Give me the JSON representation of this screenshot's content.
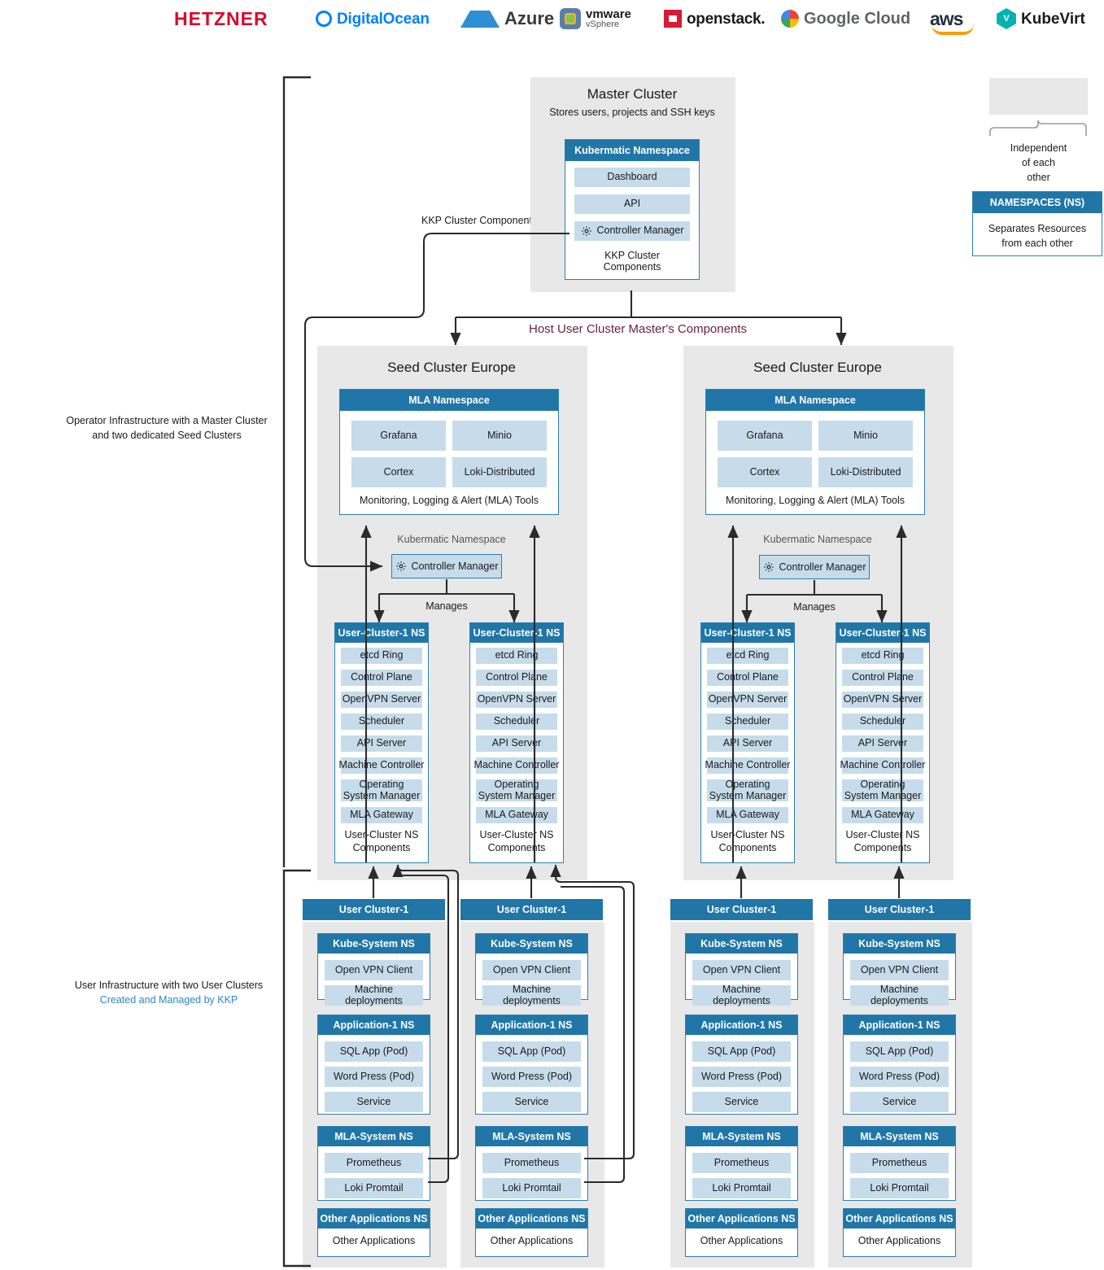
{
  "logos": [
    {
      "name": "hetzner",
      "text": "HETZNER",
      "color": "#d50c2d"
    },
    {
      "name": "digitalocean",
      "text": "DigitalOcean",
      "color": "#0080ff"
    },
    {
      "name": "azure",
      "text": "Azure",
      "color": "#3a3a3a"
    },
    {
      "name": "vmware-vsphere",
      "text": "vmware",
      "subtext": "vSphere",
      "color": "#1a1a1a"
    },
    {
      "name": "openstack",
      "text": "openstack.",
      "color": "#1a1a1a"
    },
    {
      "name": "google-cloud",
      "text": "Google Cloud",
      "color": "#5f6368"
    },
    {
      "name": "aws",
      "text": "aws",
      "color": "#232f3e"
    },
    {
      "name": "kubevirt",
      "text": "KubeVirt",
      "color": "#1a1a1a"
    }
  ],
  "annotations": {
    "operator_infra_line1": "Operator Infrastructure with a Master Cluster",
    "operator_infra_line2": "and two dedicated Seed Clusters",
    "user_infra_line1": "User Infrastructure with two User Clusters",
    "user_infra_line2": "Created and Managed by KKP",
    "kkp_cluster_component": "KKP Cluster Component",
    "host_user_cluster": "Host User Cluster Master's Components",
    "manages": "Manages"
  },
  "colors": {
    "header_blue": "#2176a8",
    "chip_blue": "#c6dcea",
    "container_gray": "#e8e8e8",
    "maroon": "#6b1f3a",
    "link_blue": "#2e7eb0"
  },
  "master_cluster": {
    "title": "Master Cluster",
    "subtitle": "Stores users, projects and SSH keys",
    "namespace": {
      "header": "Kubermatic Namespace",
      "items": [
        "Dashboard",
        "API"
      ],
      "controller_manager": "Controller Manager",
      "footer": "KKP Cluster Components"
    }
  },
  "legend": {
    "independent_line1": "Independent",
    "independent_line2": "of each",
    "independent_line3": "other",
    "namespaces_header": "NAMESPACES (NS)",
    "namespaces_body_line1": "Separates Resources",
    "namespaces_body_line2": "from each other"
  },
  "seed_clusters": [
    {
      "title": "Seed Cluster Europe",
      "mla": {
        "header": "MLA Namespace",
        "items": [
          "Grafana",
          "Minio",
          "Cortex",
          "Loki-Distributed"
        ],
        "footer": "Monitoring, Logging & Alert (MLA) Tools"
      },
      "kubermatic_namespace_label": "Kubermatic Namespace",
      "controller_manager": "Controller Manager",
      "manages": "Manages",
      "user_cluster_ns": [
        {
          "header": "User-Cluster-1 NS",
          "items": [
            "etcd Ring",
            "Control Plane",
            "OpenVPN Server",
            "Scheduler",
            "API Server",
            "Machine Controller",
            "Operating System Manager",
            "MLA Gateway"
          ],
          "footer_line1": "User-Cluster NS",
          "footer_line2": "Components"
        },
        {
          "header": "User-Cluster-1 NS",
          "items": [
            "etcd Ring",
            "Control Plane",
            "OpenVPN Server",
            "Scheduler",
            "API Server",
            "Machine Controller",
            "Operating System Manager",
            "MLA Gateway"
          ],
          "footer_line1": "User-Cluster NS",
          "footer_line2": "Components"
        }
      ]
    },
    {
      "title": "Seed Cluster Europe",
      "mla": {
        "header": "MLA Namespace",
        "items": [
          "Grafana",
          "Minio",
          "Cortex",
          "Loki-Distributed"
        ],
        "footer": "Monitoring, Logging & Alert (MLA) Tools"
      },
      "kubermatic_namespace_label": "Kubermatic Namespace",
      "controller_manager": "Controller Manager",
      "manages": "Manages",
      "user_cluster_ns": [
        {
          "header": "User-Cluster-1 NS",
          "items": [
            "etcd Ring",
            "Control Plane",
            "OpenVPN Server",
            "Scheduler",
            "API Server",
            "Machine Controller",
            "Operating System Manager",
            "MLA Gateway"
          ],
          "footer_line1": "User-Cluster NS",
          "footer_line2": "Components"
        },
        {
          "header": "User-Cluster-1 NS",
          "items": [
            "etcd Ring",
            "Control Plane",
            "OpenVPN Server",
            "Scheduler",
            "API Server",
            "Machine Controller",
            "Operating System Manager",
            "MLA Gateway"
          ],
          "footer_line1": "User-Cluster NS",
          "footer_line2": "Components"
        }
      ]
    }
  ],
  "user_clusters": [
    {
      "header": "User Cluster-1",
      "namespaces": [
        {
          "header": "Kube-System NS",
          "items": [
            "Open VPN Client",
            "Machine deployments"
          ]
        },
        {
          "header": "Application-1 NS",
          "items": [
            "SQL App (Pod)",
            "Word Press (Pod)",
            "Service"
          ]
        },
        {
          "header": "MLA-System NS",
          "items": [
            "Prometheus",
            "Loki Promtail"
          ]
        },
        {
          "header": "Other Applications NS",
          "items": [
            "Other Applications"
          ],
          "plain": true
        }
      ]
    },
    {
      "header": "User Cluster-1",
      "namespaces": [
        {
          "header": "Kube-System NS",
          "items": [
            "Open VPN Client",
            "Machine deployments"
          ]
        },
        {
          "header": "Application-1 NS",
          "items": [
            "SQL App (Pod)",
            "Word Press (Pod)",
            "Service"
          ]
        },
        {
          "header": "MLA-System NS",
          "items": [
            "Prometheus",
            "Loki Promtail"
          ]
        },
        {
          "header": "Other Applications NS",
          "items": [
            "Other Applications"
          ],
          "plain": true
        }
      ]
    },
    {
      "header": "User Cluster-1",
      "namespaces": [
        {
          "header": "Kube-System NS",
          "items": [
            "Open VPN Client",
            "Machine deployments"
          ]
        },
        {
          "header": "Application-1 NS",
          "items": [
            "SQL App (Pod)",
            "Word Press (Pod)",
            "Service"
          ]
        },
        {
          "header": "MLA-System NS",
          "items": [
            "Prometheus",
            "Loki Promtail"
          ]
        },
        {
          "header": "Other Applications NS",
          "items": [
            "Other Applications"
          ],
          "plain": true
        }
      ]
    },
    {
      "header": "User Cluster-1",
      "namespaces": [
        {
          "header": "Kube-System NS",
          "items": [
            "Open VPN Client",
            "Machine deployments"
          ]
        },
        {
          "header": "Application-1 NS",
          "items": [
            "SQL App (Pod)",
            "Word Press (Pod)",
            "Service"
          ]
        },
        {
          "header": "MLA-System NS",
          "items": [
            "Prometheus",
            "Loki Promtail"
          ]
        },
        {
          "header": "Other Applications NS",
          "items": [
            "Other Applications"
          ],
          "plain": true
        }
      ]
    }
  ]
}
